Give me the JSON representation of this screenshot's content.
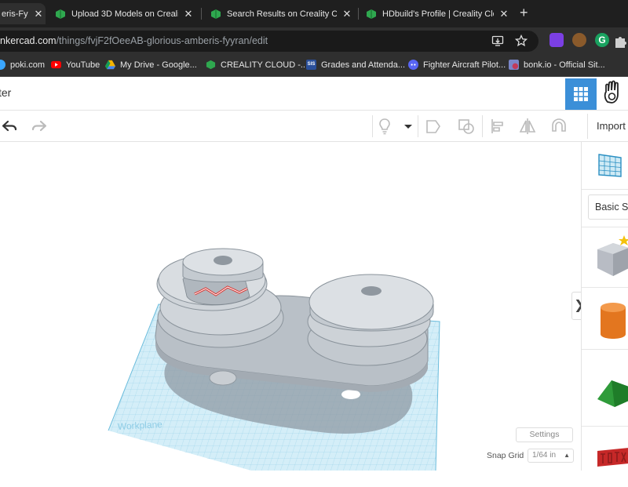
{
  "browser": {
    "tabs": [
      {
        "title": "eris-Fy",
        "favicon": "tinkercad-icon",
        "active": true
      },
      {
        "title": "Upload 3D Models on Creality C",
        "favicon": "creality-icon",
        "active": false
      },
      {
        "title": "Search Results on Creality Clou",
        "favicon": "creality-icon",
        "active": false
      },
      {
        "title": "HDbuild's Profile | Creality Clou",
        "favicon": "creality-icon",
        "active": false
      }
    ],
    "new_tab_label": "+",
    "url_host": "nkercad.com",
    "url_path": "/things/fvjF2fOeeAB-glorious-amberis-fyyran/edit",
    "bookmarks": [
      {
        "label": "poki.com",
        "icon": "poki-icon",
        "color": "#3aa6ff"
      },
      {
        "label": "YouTube",
        "icon": "youtube-icon",
        "color": "#ff0000"
      },
      {
        "label": "My Drive - Google...",
        "icon": "google-drive-icon",
        "color": "#f4b400"
      },
      {
        "label": "CREALITY CLOUD -...",
        "icon": "creality-icon",
        "color": "#2fa84f"
      },
      {
        "label": "Grades and Attenda...",
        "icon": "sis-icon",
        "color": "#2a4f9a"
      },
      {
        "label": "Fighter Aircraft Pilot...",
        "icon": "discord-icon",
        "color": "#5865f2"
      },
      {
        "label": "bonk.io - Official Sit...",
        "icon": "bonk-icon",
        "color": "#c23a5a"
      }
    ],
    "sis_text": "SIS"
  },
  "app": {
    "title": "ter",
    "accent": "#3b8fd8",
    "toolbar": {
      "import_label": "Import"
    }
  },
  "workspace": {
    "workplane_label": "Workplane",
    "settings_label": "Settings",
    "snap_grid_label": "Snap Grid",
    "snap_grid_value": "1/64 in",
    "collapse_glyph": "❯"
  },
  "shapes_panel": {
    "category_label": "Basic Sh",
    "items": [
      {
        "name": "box",
        "color": "#b8bcc4"
      },
      {
        "name": "cylinder",
        "color": "#e3761f"
      },
      {
        "name": "roof",
        "color": "#2f9b3a"
      },
      {
        "name": "text",
        "color": "#c62828"
      }
    ]
  }
}
